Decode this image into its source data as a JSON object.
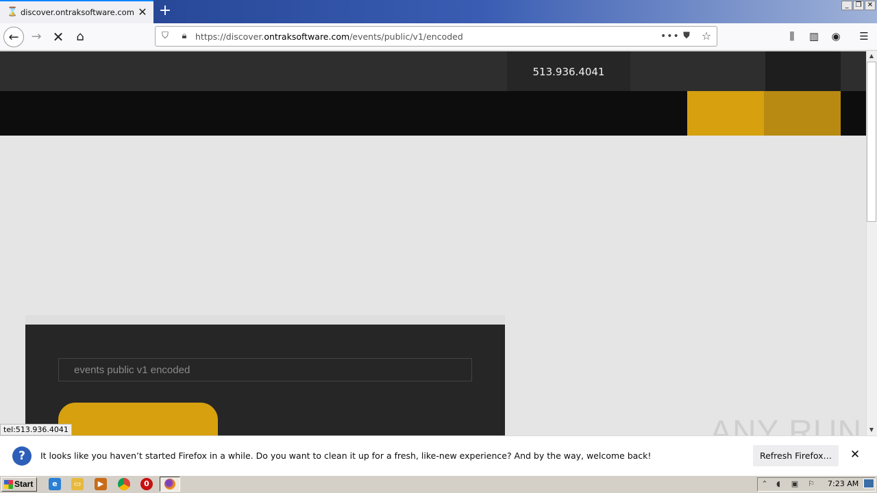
{
  "browser": {
    "tab_title": "discover.ontraksoftware.com/even",
    "tab_icon": "hourglass-icon",
    "url_prefix": "https://discover.",
    "url_domain": "ontraksoftware.com",
    "url_path": "/events/public/v1/encoded",
    "accent": "#0a84ff"
  },
  "page": {
    "phone": "513.936.4041",
    "search_value": "events public v1 encoded",
    "brand_gold": "#d6a00f",
    "brand_gold_dark": "#b88a11"
  },
  "status_link": "tel:513.936.4041",
  "notification": {
    "message": "It looks like you haven’t started Firefox in a while. Do you want to clean it up for a fresh, like-new experience? And by the way, welcome back!",
    "button": "Refresh Firefox…"
  },
  "watermark": "ANY RUN",
  "taskbar": {
    "start_label": "Start",
    "clock": "7:23 AM"
  }
}
